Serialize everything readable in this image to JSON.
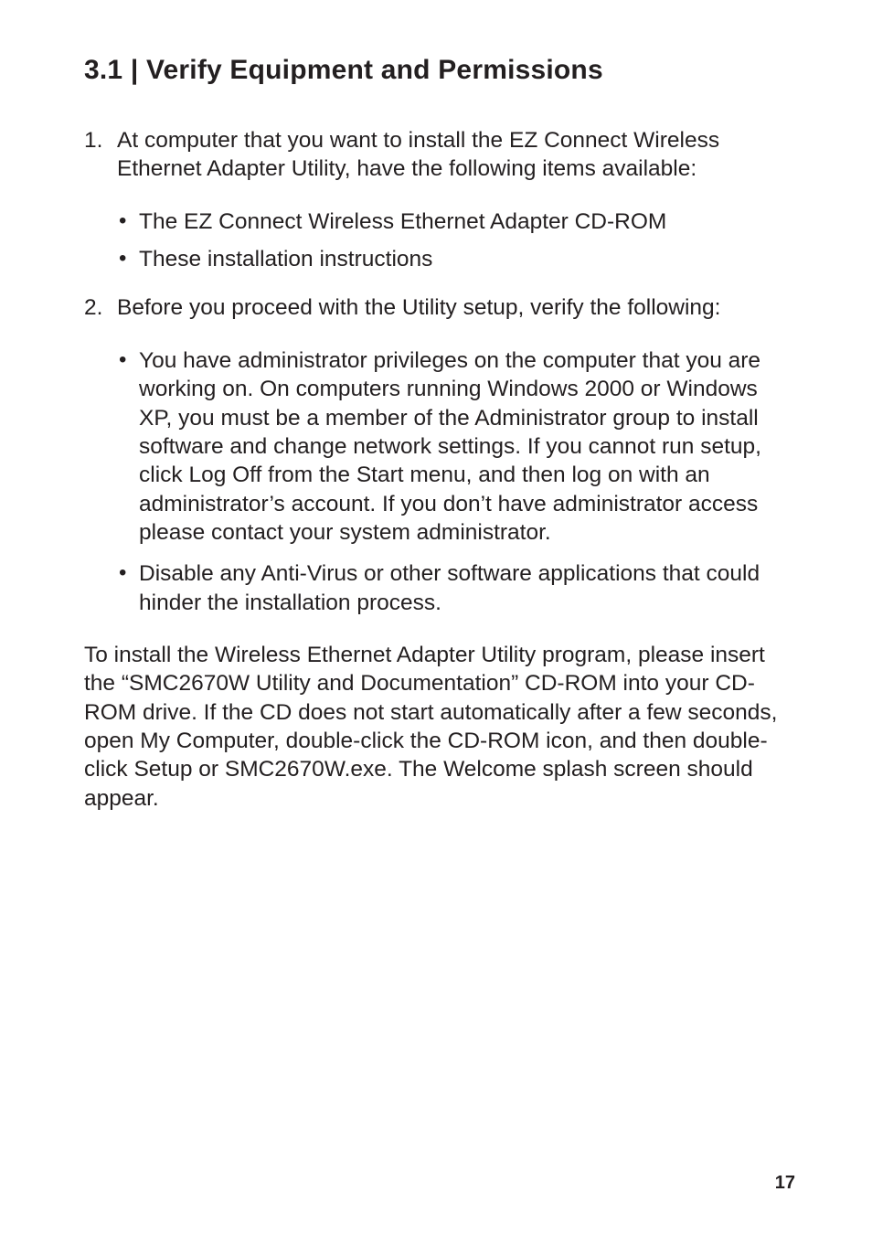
{
  "heading": "3.1 | Verify Equipment and Permissions",
  "list": [
    {
      "text": "At computer that you want to install the EZ Connect Wireless Ethernet Adapter Utility, have the following items available:",
      "sub": [
        "The EZ Connect Wireless Ethernet Adapter CD-ROM",
        "These installation instructions"
      ]
    },
    {
      "text": "Before you proceed with the Utility setup, verify the following:",
      "sub": [
        "You have administrator privileges on the computer that you are working on. On computers running Windows 2000 or Windows XP, you must be a member of the Administrator group to install software and change network settings. If you cannot run setup, click Log Off from the Start menu, and then log on with an administrator’s account. If you don’t have administrator access please contact your system administrator.",
        "Disable any Anti-Virus or other software applications that could hinder the installation process."
      ]
    }
  ],
  "paragraph": "To install the Wireless Ethernet Adapter Utility program, please insert the “SMC2670W Utility and Documentation” CD-ROM into your CD-ROM drive. If the CD does not start automatically after a few seconds, open My Computer, double-click the CD-ROM icon, and then double-click Setup or SMC2670W.exe. The Welcome splash screen should appear.",
  "page_number": "17"
}
